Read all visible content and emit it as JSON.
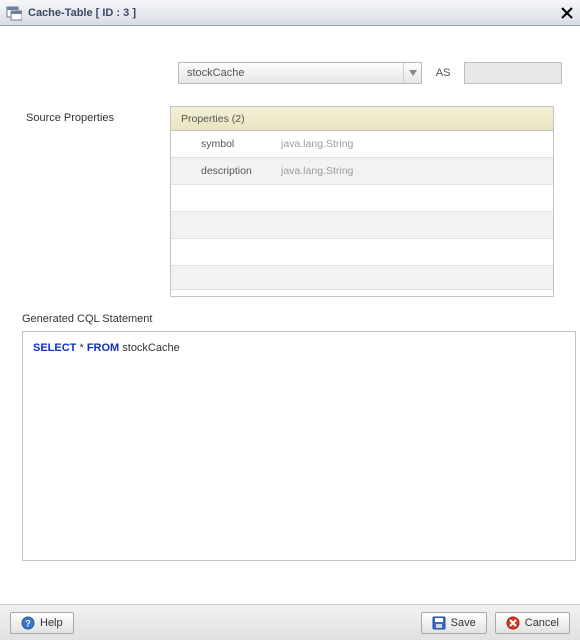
{
  "title": "Cache-Table [ ID : 3 ]",
  "source": {
    "selected": "stockCache",
    "as_label": "AS",
    "alias": ""
  },
  "source_properties": {
    "section_label": "Source Properties",
    "header": "Properties (2)",
    "rows": [
      {
        "name": "symbol",
        "type": "java.lang.String"
      },
      {
        "name": "description",
        "type": "java.lang.String"
      }
    ]
  },
  "cql": {
    "label": "Generated CQL Statement",
    "keywords": {
      "select": "SELECT",
      "from": "FROM"
    },
    "text_star": " * ",
    "table": " stockCache"
  },
  "buttons": {
    "help": "Help",
    "save": "Save",
    "cancel": "Cancel"
  }
}
